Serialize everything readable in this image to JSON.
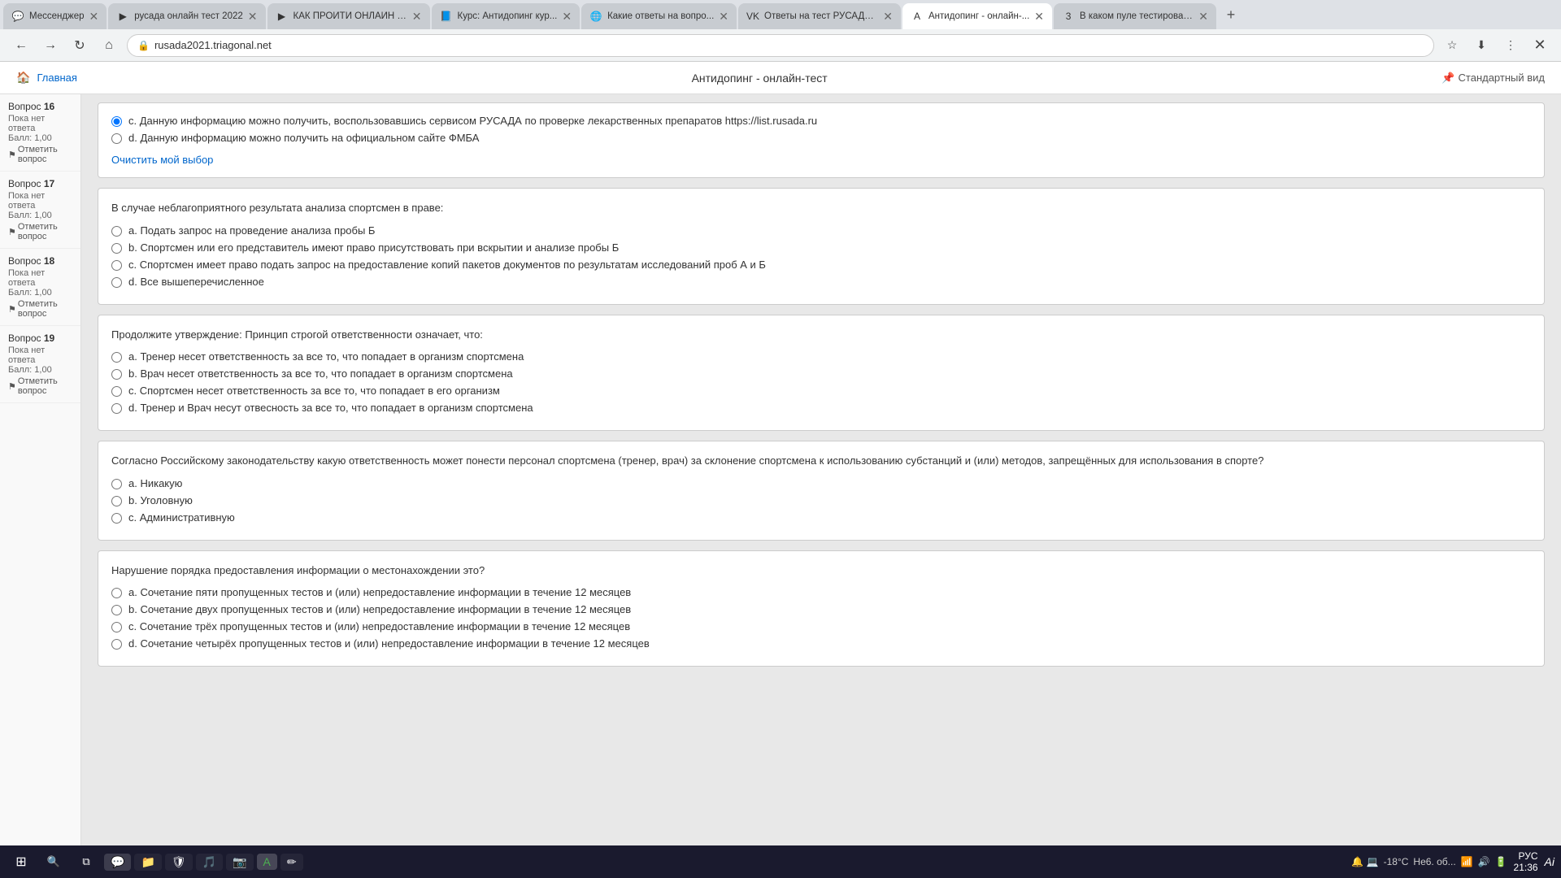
{
  "browser": {
    "tabs": [
      {
        "id": "t1",
        "label": "Мессенджер",
        "icon": "💬",
        "active": false,
        "color": "#1877f2"
      },
      {
        "id": "t2",
        "label": "русада онлайн тест 2022",
        "icon": "▶",
        "active": false,
        "color": "#ff0000"
      },
      {
        "id": "t3",
        "label": "КАК ПРОЙТИ ОНЛАЙН Т...",
        "icon": "▶",
        "active": false,
        "color": "#ff0000"
      },
      {
        "id": "t4",
        "label": "Курс: Антидопинг кур...",
        "icon": "📘",
        "active": false,
        "color": "#e67e22"
      },
      {
        "id": "t5",
        "label": "Какие ответы на вопро...",
        "icon": "🌐",
        "active": false,
        "color": "#4caf50"
      },
      {
        "id": "t6",
        "label": "Ответы на тест РУСАДА 2...",
        "icon": "VK",
        "active": false,
        "color": "#4a76a8"
      },
      {
        "id": "t7",
        "label": "Антидопинг - онлайн-...",
        "icon": "A",
        "active": true,
        "color": "#e91e63"
      },
      {
        "id": "t8",
        "label": "В каком пуле тестирован...",
        "icon": "3",
        "active": false,
        "color": "#2196f3"
      }
    ],
    "url": "rusada2021.triagonal.net",
    "page_title": "Антидопинг - онлайн-тест"
  },
  "page": {
    "header": {
      "home_label": "Главная",
      "standard_view": "Стандартный вид"
    }
  },
  "sidebar": {
    "items": [
      {
        "question_label": "Вопрос",
        "question_num": "16",
        "status": "Пока нет ответа",
        "score_label": "Балл:",
        "score_val": "1,00",
        "flag_label": "Отметить вопрос"
      },
      {
        "question_label": "Вопрос",
        "question_num": "17",
        "status": "Пока нет ответа",
        "score_label": "Балл:",
        "score_val": "1,00",
        "flag_label": "Отметить вопрос"
      },
      {
        "question_label": "Вопрос",
        "question_num": "18",
        "status": "Пока нет ответа",
        "score_label": "Балл:",
        "score_val": "1,00",
        "flag_label": "Отметить вопрос"
      },
      {
        "question_label": "Вопрос",
        "question_num": "19",
        "status": "Пока нет ответа",
        "score_label": "Балл:",
        "score_val": "1,00",
        "flag_label": "Отметить вопрос"
      }
    ]
  },
  "questions": [
    {
      "id": "q_top",
      "text": "",
      "options": [
        {
          "label": "c.",
          "text": "Данную информацию можно получить, воспользовавшись сервисом РУСАДА по проверке лекарственных препаратов https://list.rusada.ru",
          "selected": true
        },
        {
          "label": "d.",
          "text": "Данную информацию можно получить на официальном сайте ФМБА",
          "selected": false
        }
      ],
      "clear_label": "Очистить мой выбор"
    },
    {
      "id": "q16",
      "num": "16",
      "text": "В случае неблагоприятного результата анализа спортсмен в праве:",
      "options": [
        {
          "label": "a.",
          "text": "Подать запрос на проведение анализа пробы Б",
          "selected": false
        },
        {
          "label": "b.",
          "text": "Спортсмен или его представитель имеют право присутствовать при вскрытии и анализе пробы Б",
          "selected": false
        },
        {
          "label": "c.",
          "text": "Спортсмен имеет право подать запрос на предоставление копий пакетов документов по результатам исследований проб А и Б",
          "selected": false
        },
        {
          "label": "d.",
          "text": "Все вышеперечисленное",
          "selected": false
        }
      ]
    },
    {
      "id": "q17",
      "num": "17",
      "text": "Продолжите утверждение: Принцип строгой ответственности означает, что:",
      "options": [
        {
          "label": "a.",
          "text": "Тренер несет ответственность за все то, что попадает в организм спортсмена",
          "selected": false
        },
        {
          "label": "b.",
          "text": "Врач несет ответственность за все то, что попадает в организм спортсмена",
          "selected": false
        },
        {
          "label": "c.",
          "text": "Спортсмен несет ответственность за все то, что попадает в его организм",
          "selected": false
        },
        {
          "label": "d.",
          "text": "Тренер и Врач несут отвесность за все то, что попадает в организм спортсмена",
          "selected": false
        }
      ]
    },
    {
      "id": "q18",
      "num": "18",
      "text": "Согласно Российскому законодательству какую ответственность может понести персонал спортсмена (тренер, врач) за склонение спортсмена к использованию субстанций и (или) методов, запрещённых для использования в спорте?",
      "options": [
        {
          "label": "a.",
          "text": "Никакую",
          "selected": false
        },
        {
          "label": "b.",
          "text": "Уголовную",
          "selected": false
        },
        {
          "label": "c.",
          "text": "Административную",
          "selected": false
        }
      ]
    },
    {
      "id": "q19",
      "num": "19",
      "text": "Нарушение порядка предоставления информации о местонахождении это?",
      "options": [
        {
          "label": "a.",
          "text": "Сочетание пяти пропущенных тестов и (или) непредоставление информации в течение 12 месяцев",
          "selected": false
        },
        {
          "label": "b.",
          "text": "Сочетание двух пропущенных тестов и (или) непредоставление информации в течение 12 месяцев",
          "selected": false
        },
        {
          "label": "c.",
          "text": "Сочетание трёх пропущенных тестов и (или) непредоставление информации в течение 12 месяцев",
          "selected": false
        },
        {
          "label": "d.",
          "text": "Сочетание четырёх пропущенных тестов и (или) непредоставление информации в течение 12 месяцев",
          "selected": false
        }
      ]
    }
  ],
  "taskbar": {
    "apps": [
      {
        "icon": "⊞",
        "name": "start"
      },
      {
        "icon": "🔍",
        "name": "search"
      },
      {
        "icon": "⊟",
        "name": "task-view"
      },
      {
        "icon": "📁",
        "name": "explorer"
      },
      {
        "icon": "🌐",
        "name": "browser-taskbar"
      },
      {
        "icon": "📂",
        "name": "files"
      },
      {
        "icon": "🛡",
        "name": "antivirus"
      },
      {
        "icon": "🎵",
        "name": "music"
      },
      {
        "icon": "📷",
        "name": "camera"
      },
      {
        "icon": "✏",
        "name": "editor"
      }
    ],
    "system_tray": {
      "temp": "-18°С",
      "weather": "Не6. об...",
      "time": "21:36",
      "lang": "РУС"
    }
  }
}
